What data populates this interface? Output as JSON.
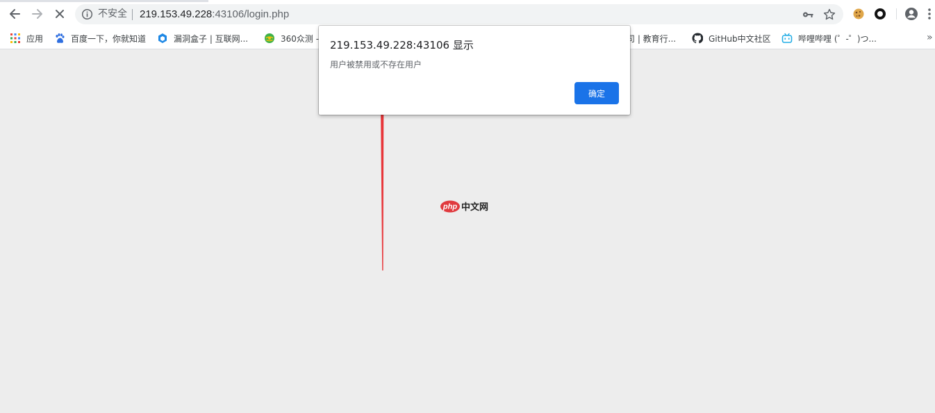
{
  "browser": {
    "security_label": "不安全",
    "url_host": "219.153.49.228",
    "url_rest": ":43106/login.php"
  },
  "bookmarks": [
    {
      "label": "应用",
      "icon": "apps-grid-icon"
    },
    {
      "label": "百度一下，你就知道",
      "icon": "baidu-paw-icon"
    },
    {
      "label": "漏洞盒子 | 互联网...",
      "icon": "vulbox-hexagon-icon"
    },
    {
      "label": "360众测 -",
      "icon": "360-globe-icon"
    },
    {
      "label": "司 | 教育行...",
      "icon": "education-icon"
    },
    {
      "label": "GitHub中文社区",
      "icon": "github-icon"
    },
    {
      "label": "哔哩哔哩 (゜-゜)つ...",
      "icon": "bilibili-tv-icon"
    }
  ],
  "dialog": {
    "title": "219.153.49.228:43106 显示",
    "message": "用户被禁用或不存在用户",
    "ok_label": "确定"
  },
  "watermark": {
    "logo_text": "php",
    "site_name": "中文网"
  },
  "colors": {
    "accent": "#1a73e8",
    "annotation_arrow": "#e8363a",
    "page_background": "#ededed"
  }
}
